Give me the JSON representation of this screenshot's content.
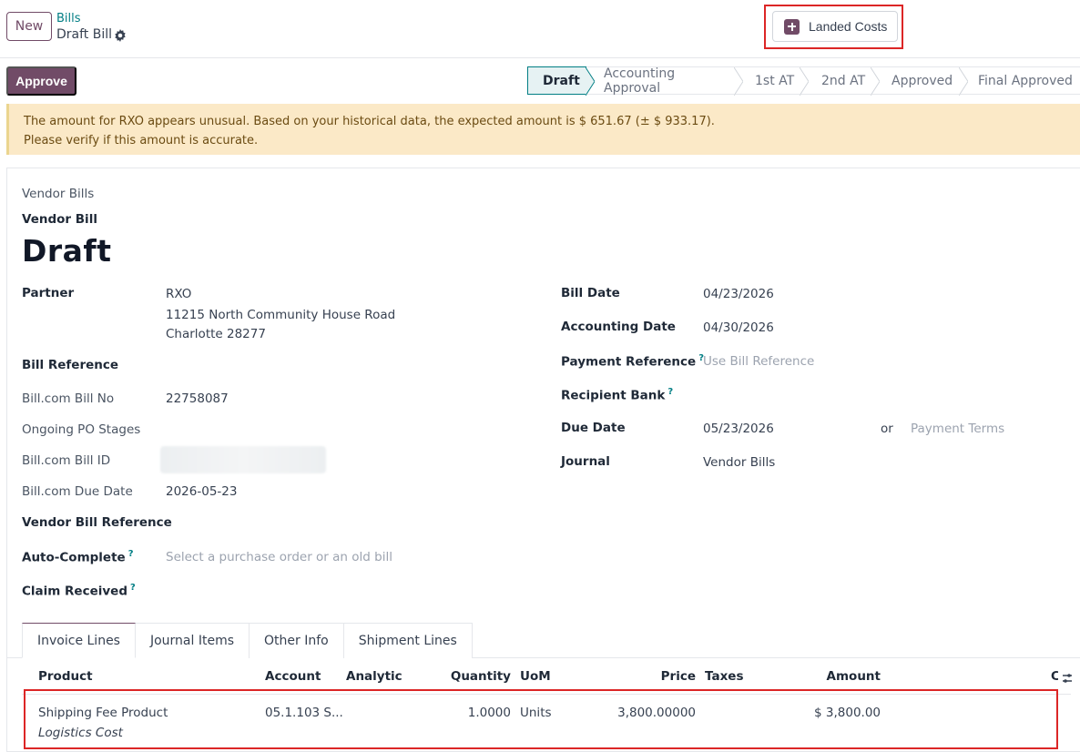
{
  "control_panel": {
    "new_label": "New",
    "breadcrumb_parent": "Bills",
    "breadcrumb_current": "Draft Bill",
    "landed_costs_label": "Landed Costs"
  },
  "actions": {
    "approve_label": "Approve"
  },
  "statusbar": {
    "stages": [
      "Draft",
      "Accounting Approval",
      "1st AT",
      "2nd AT",
      "Approved",
      "Final Approved"
    ],
    "active": "Draft"
  },
  "warning": {
    "line1": "The amount for RXO appears unusual. Based on your historical data, the expected amount is $ 651.67 (± $ 933.17).",
    "line2": "Please verify if this amount is accurate."
  },
  "form": {
    "journal_caption": "Vendor Bills",
    "move_type": "Vendor Bill",
    "name": "Draft",
    "left": {
      "partner_label": "Partner",
      "partner_name": "RXO",
      "partner_street": "11215 North Community House Road",
      "partner_city": "Charlotte 28277",
      "bill_reference_label": "Bill Reference",
      "billcom_no_label": "Bill.com Bill No",
      "billcom_no_value": "22758087",
      "ongoing_po_label": "Ongoing PO Stages",
      "billcom_id_label": "Bill.com Bill ID",
      "billcom_due_label": "Bill.com Due Date",
      "billcom_due_value": "2026-05-23",
      "vendor_bill_ref_label": "Vendor Bill Reference",
      "autocomplete_label": "Auto-Complete",
      "autocomplete_placeholder": "Select a purchase order or an old bill",
      "claim_received_label": "Claim Received"
    },
    "right": {
      "bill_date_label": "Bill Date",
      "bill_date_value": "04/23/2026",
      "accounting_date_label": "Accounting Date",
      "accounting_date_value": "04/30/2026",
      "payment_ref_label": "Payment Reference",
      "payment_ref_placeholder": "Use Bill Reference",
      "recipient_bank_label": "Recipient Bank",
      "due_date_label": "Due Date",
      "due_date_value": "05/23/2026",
      "or_text": "or",
      "payment_terms_placeholder": "Payment Terms",
      "journal_label": "Journal",
      "journal_value": "Vendor Bills"
    },
    "help_mark": "?"
  },
  "tabs": [
    "Invoice Lines",
    "Journal Items",
    "Other Info",
    "Shipment Lines"
  ],
  "invoice_lines": {
    "columns": [
      "Product",
      "Account",
      "Analytic",
      "Quantity",
      "UoM",
      "Price",
      "Taxes",
      "Amount",
      "C"
    ],
    "rows": [
      {
        "product": "Shipping Fee Product",
        "description": "Logistics Cost",
        "account": "05.1.103 S...",
        "analytic": "",
        "quantity": "1.0000",
        "uom": "Units",
        "price": "3,800.00000",
        "taxes": "",
        "amount": "$ 3,800.00"
      }
    ]
  },
  "colors": {
    "brand": "#714b67",
    "link": "#017e84",
    "warning_bg": "#fbe9c7",
    "highlight_border": "#dc2626"
  }
}
